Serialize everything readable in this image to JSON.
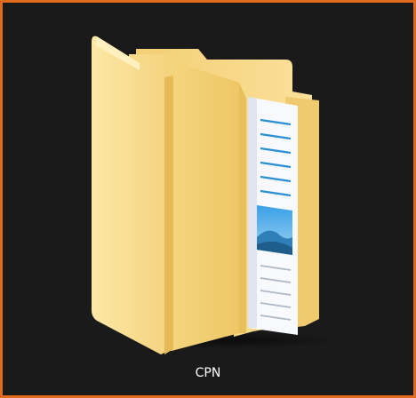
{
  "folder": {
    "name": "CPN",
    "icon": "folder-with-documents-icon",
    "selected": true
  },
  "colors": {
    "background": "#1a1a1a",
    "selection_border": "#e06b1c",
    "folder_light": "#fde7a0",
    "folder_mid": "#f6d37a",
    "folder_dark": "#e8bd57",
    "paper": "#f7f9fc",
    "paper_line": "#2a8fd6",
    "label": "#ffffff"
  }
}
